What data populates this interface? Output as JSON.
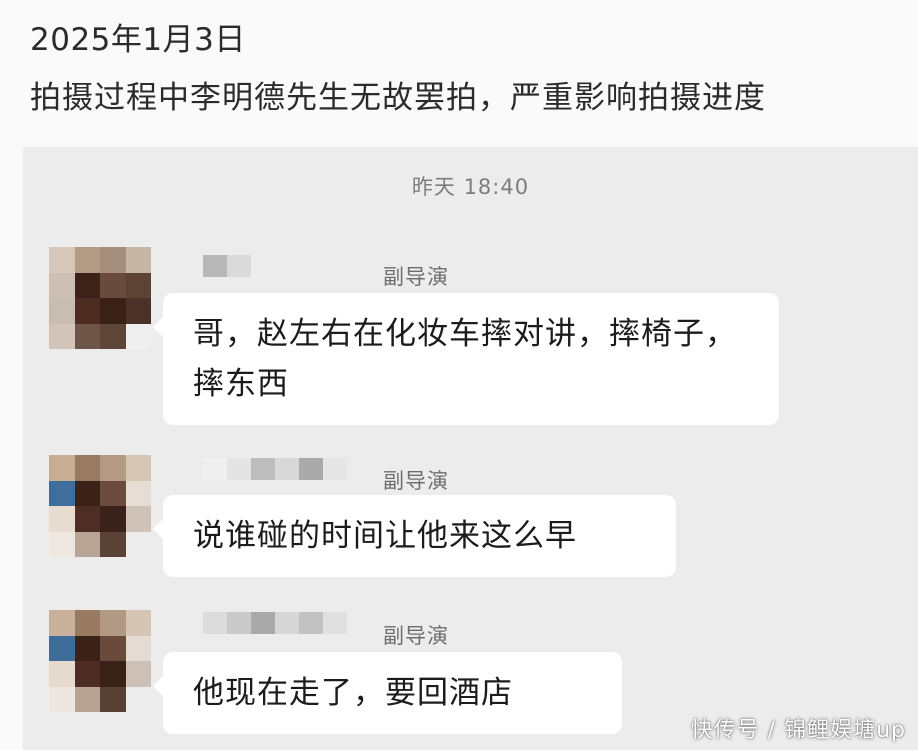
{
  "caption": {
    "date": "2025年1月3日",
    "description": "拍摄过程中李明德先生无故罢拍，严重影响拍摄进度"
  },
  "chat": {
    "timestamp": "昨天 18:40",
    "messages": [
      {
        "role": "副导演",
        "text": "哥，赵左右在化妆车摔对讲，摔椅子，摔东西"
      },
      {
        "role": "副导演",
        "text": "说谁碰的时间让他来这么早"
      },
      {
        "role": "副导演",
        "text": "他现在走了，要回酒店"
      }
    ]
  },
  "watermark": "快传号 / 锦鲤娱塘up",
  "colors": {
    "chat_background": "#ececec",
    "bubble": "#ffffff",
    "page_background": "#fafafa"
  }
}
